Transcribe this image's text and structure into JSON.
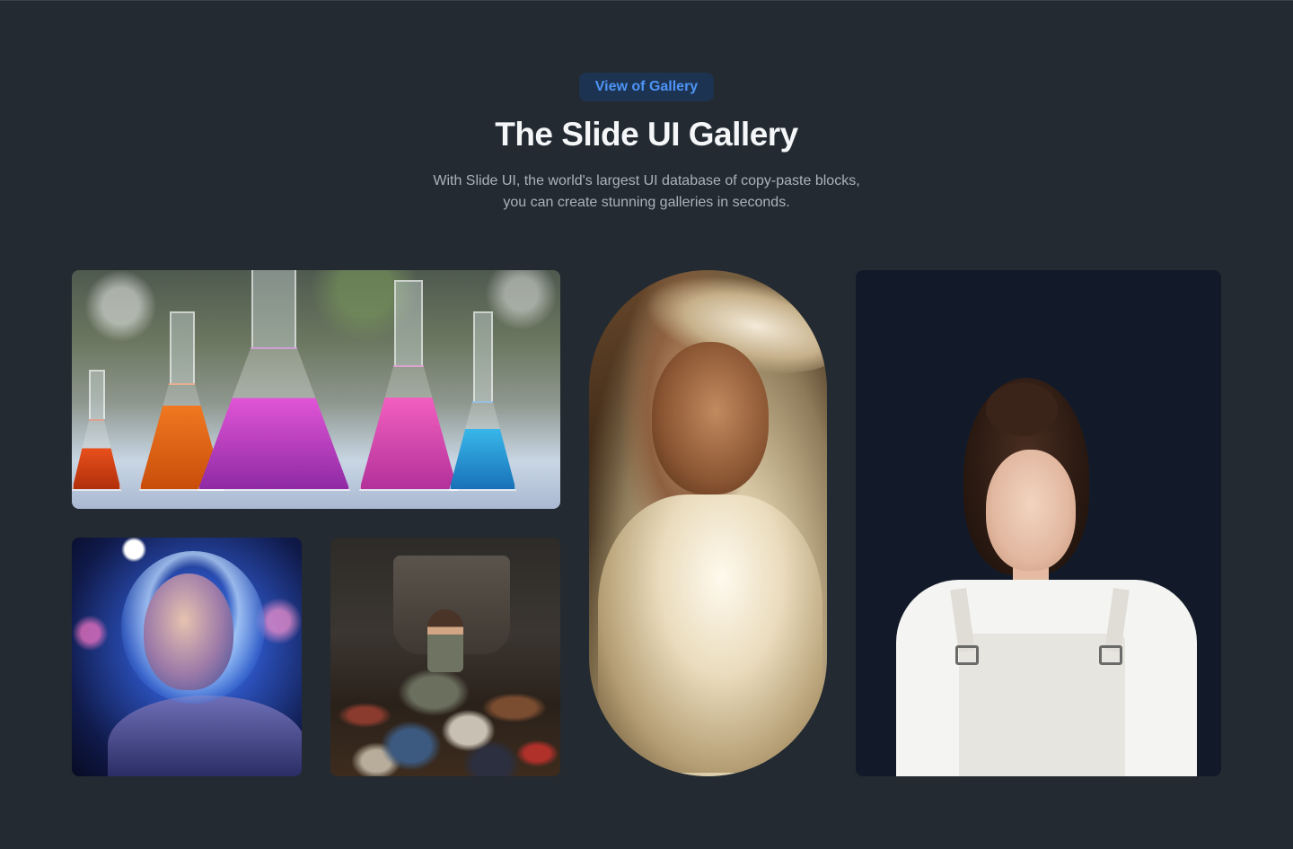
{
  "header": {
    "badge_label": "View of Gallery",
    "title": "The Slide UI Gallery",
    "subtitle_line1": "With Slide UI, the world's largest UI database of copy-paste blocks,",
    "subtitle_line2": "you can create stunning galleries in seconds."
  },
  "colors": {
    "background": "#232a31",
    "badge_bg": "#1d3352",
    "badge_text": "#4d94f5",
    "title": "#f4f6f8",
    "subtitle": "#aab2bb",
    "portrait_bg": "#121a29"
  },
  "gallery": {
    "images": [
      {
        "name": "laboratory-flasks-image"
      },
      {
        "name": "neon-woman-image"
      },
      {
        "name": "clothes-pile-image"
      },
      {
        "name": "white-scarf-portrait-image"
      },
      {
        "name": "overalls-woman-image"
      }
    ]
  }
}
